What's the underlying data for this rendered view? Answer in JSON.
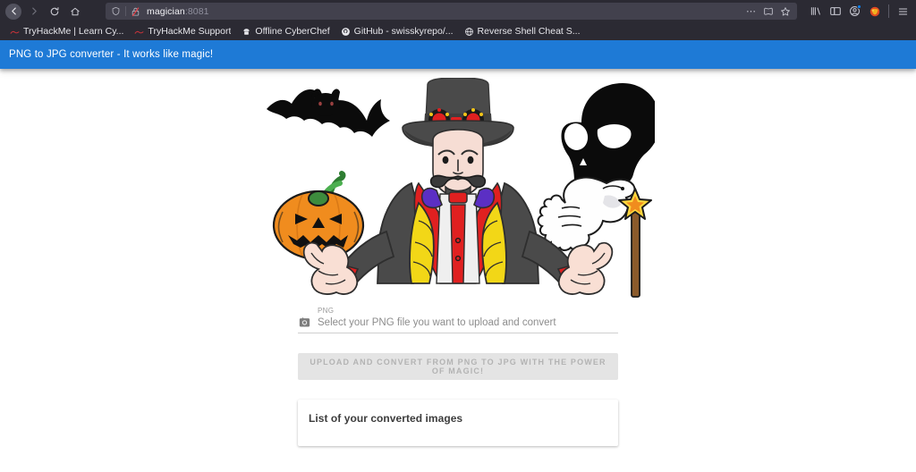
{
  "browser": {
    "nav": {
      "back_icon": "back-arrow-icon",
      "forward_icon": "forward-arrow-icon",
      "reload_icon": "reload-icon",
      "home_icon": "home-icon"
    },
    "url_bar": {
      "shield_icon": "shield-icon",
      "insecure_icon": "broken-padlock-icon",
      "host": "magician",
      "port": ":8081",
      "page_actions_icon": "ellipsis-icon",
      "reader_icon": "reader-view-icon",
      "bookmark_icon": "star-icon"
    },
    "toolbar": {
      "library_icon": "library-icon",
      "sidebar_icon": "sidebar-icon",
      "account_icon": "account-icon",
      "pocket_icon": "pocket-icon",
      "menu_icon": "hamburger-menu-icon"
    },
    "bookmarks": [
      {
        "label": "TryHackMe | Learn Cy...",
        "icon": "tryhackme-icon"
      },
      {
        "label": "TryHackMe Support",
        "icon": "tryhackme-icon"
      },
      {
        "label": "Offline CyberChef",
        "icon": "cyberchef-icon"
      },
      {
        "label": "GitHub - swisskyrepo/...",
        "icon": "github-icon"
      },
      {
        "label": "Reverse Shell Cheat S...",
        "icon": "globe-icon"
      }
    ]
  },
  "page": {
    "appbar": {
      "title": "PNG to JPG converter - It works like magic!",
      "color": "#1e7ad6"
    },
    "hero": {
      "alt": "magician-illustration",
      "elements": [
        "bat",
        "pumpkin",
        "magician",
        "skull",
        "ghost",
        "magic-wand"
      ]
    },
    "form": {
      "file_label": "PNG",
      "file_placeholder": "Select your PNG file you want to upload and convert",
      "file_icon": "camera-icon",
      "submit_label": "Upload and convert from PNG to JPG with the power of magic!"
    },
    "results": {
      "title": "List of your converted images"
    }
  }
}
